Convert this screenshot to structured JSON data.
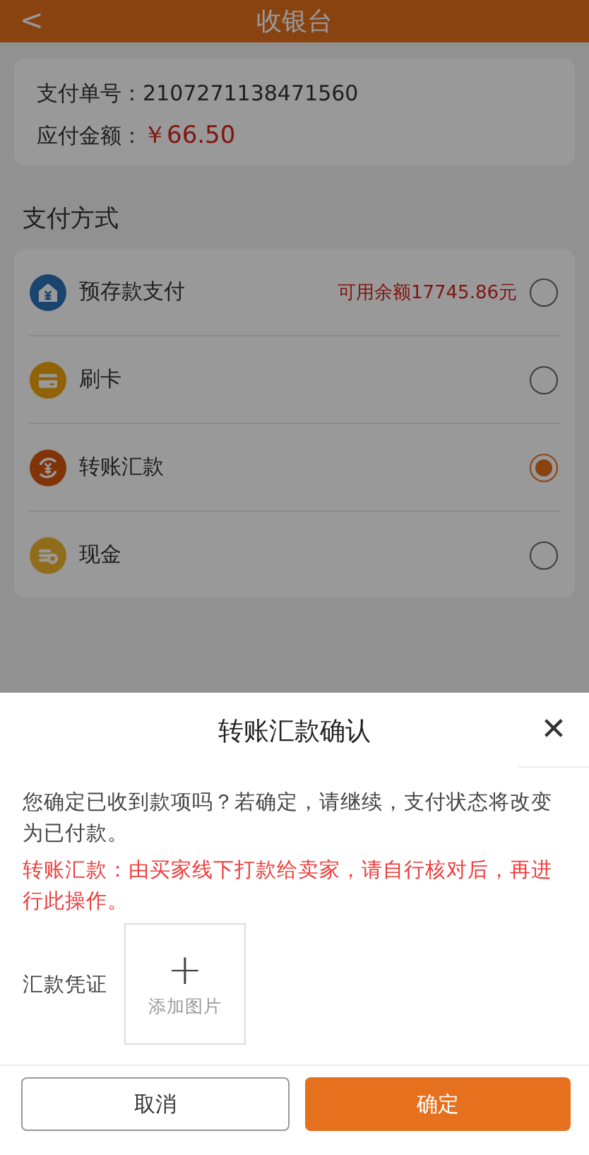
{
  "header": {
    "back": "<",
    "title": "收银台"
  },
  "order": {
    "number_label": "支付单号：",
    "number": "2107271138471560",
    "amount_label": "应付金额：",
    "amount": "￥66.50"
  },
  "methods_title": "支付方式",
  "methods": [
    {
      "kind": "prepaid",
      "label": "预存款支付",
      "note": "可用余额17745.86元",
      "selected": false
    },
    {
      "kind": "card",
      "label": "刷卡",
      "selected": false
    },
    {
      "kind": "transfer",
      "label": "转账汇款",
      "selected": true
    },
    {
      "kind": "cash",
      "label": "现金",
      "selected": false
    }
  ],
  "dialog": {
    "title": "转账汇款确认",
    "close": "✕",
    "message": "您确定已收到款项吗？若确定，请继续，支付状态将改变为已付款。",
    "warning": "转账汇款：由买家线下打款给卖家，请自行核对后，再进行此操作。",
    "voucher_label": "汇款凭证",
    "upload_plus": "+",
    "upload_label": "添加图片",
    "cancel": "取消",
    "confirm": "确定"
  }
}
